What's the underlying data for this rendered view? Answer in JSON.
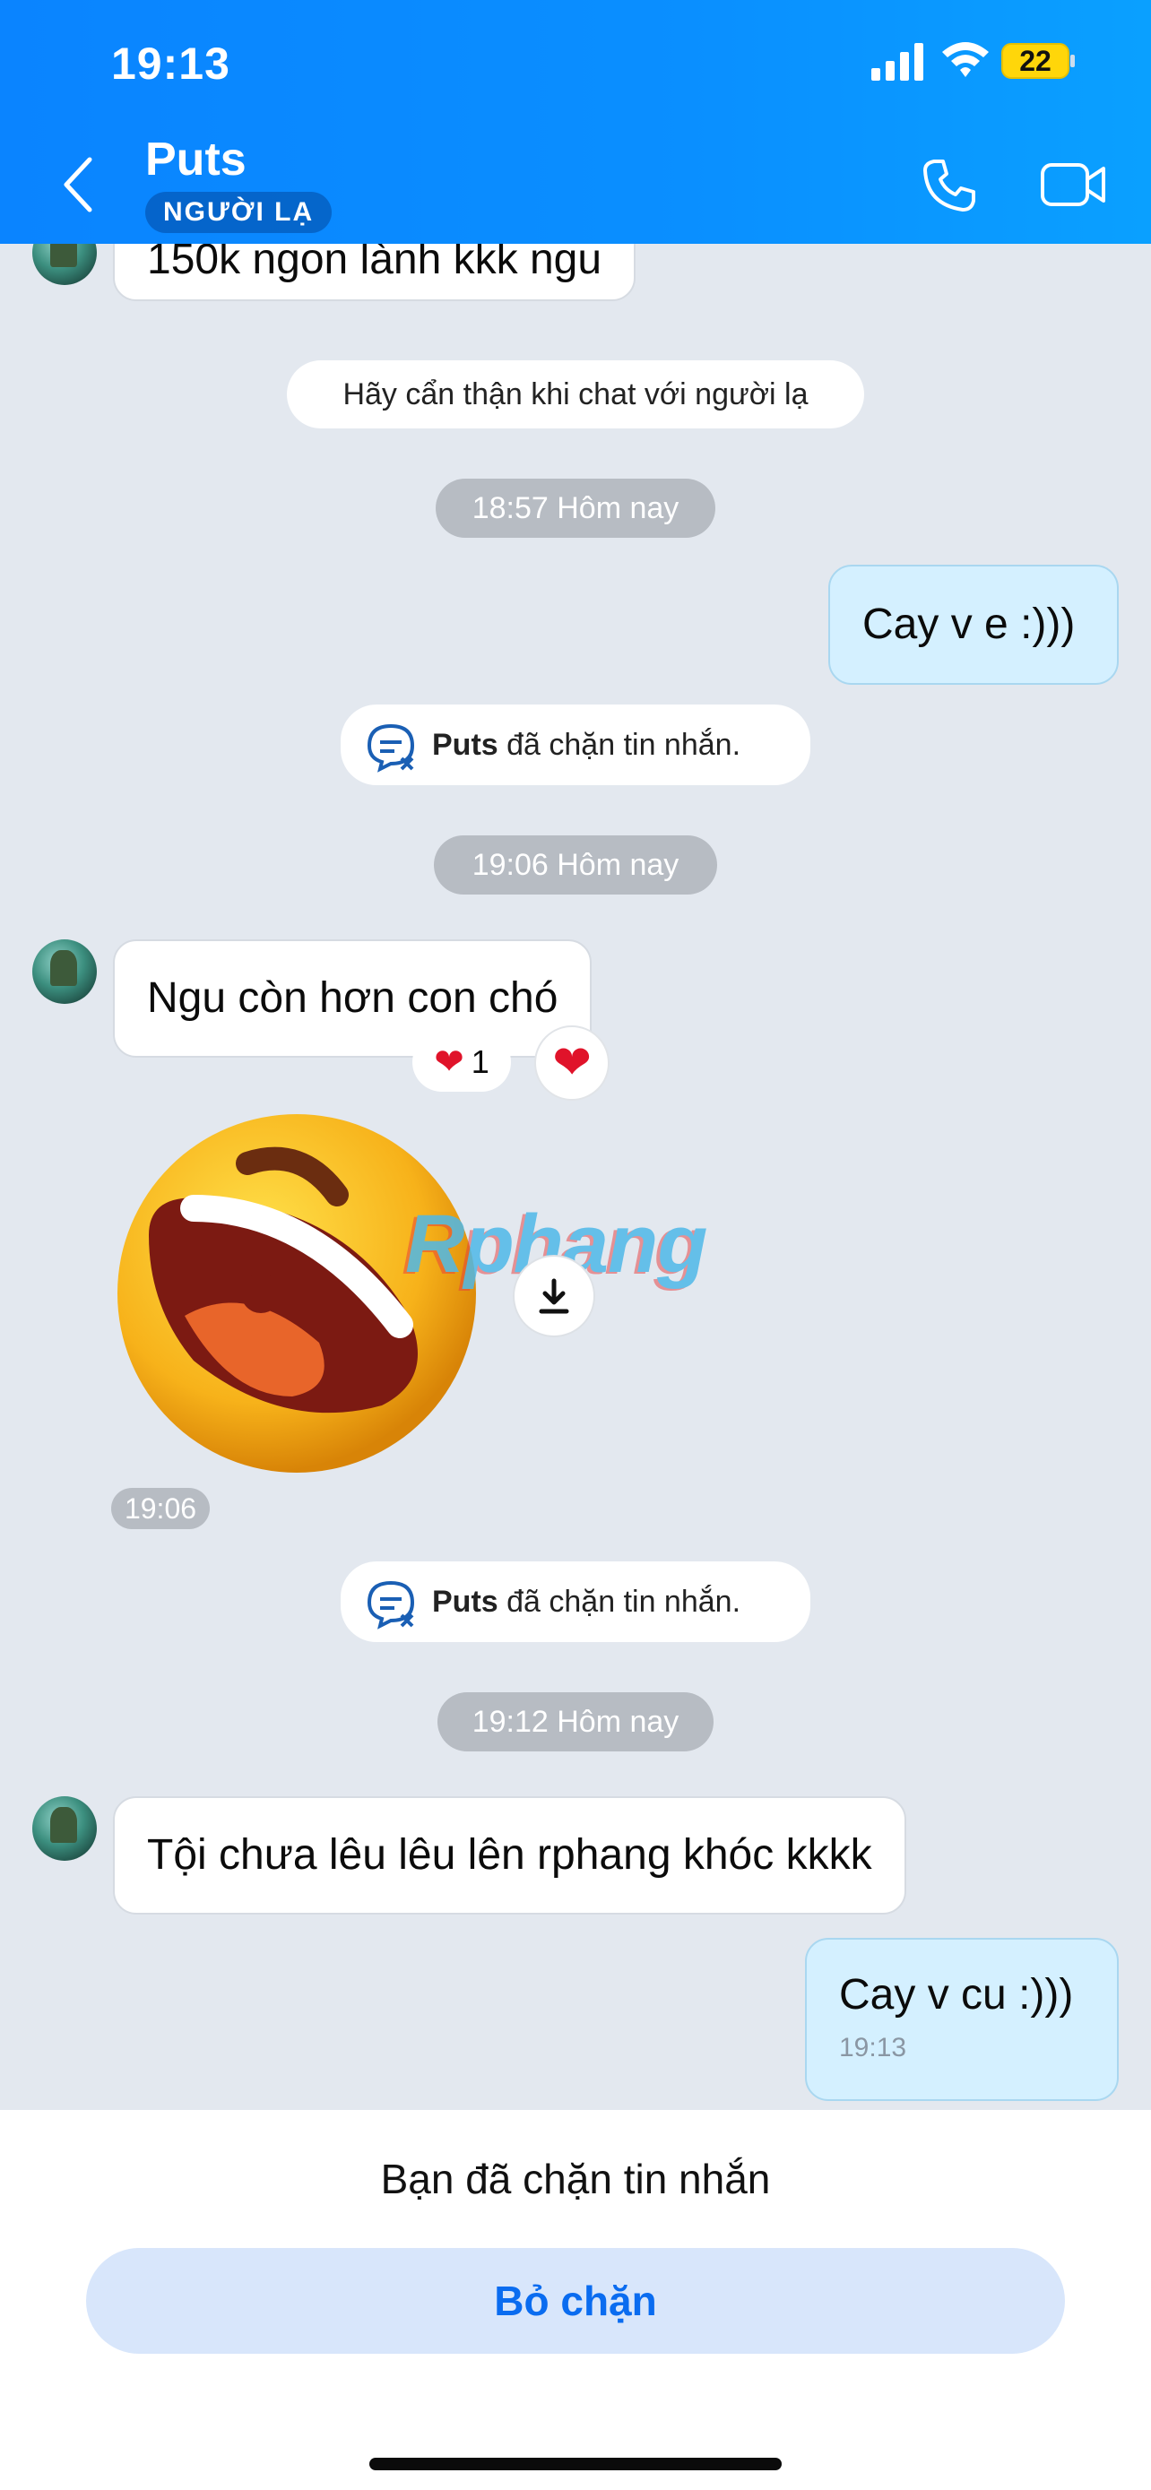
{
  "status_bar": {
    "time": "19:13",
    "battery": "22"
  },
  "header": {
    "title": "Puts",
    "badge": "NGƯỜI LẠ"
  },
  "messages": {
    "top_partial": "150k ngon lành kkk ngu",
    "warning": "Hãy cẩn thận khi chat với người lạ",
    "time1": "18:57 Hôm nay",
    "mine1": "Cay v e :)))",
    "system1": {
      "name": "Puts",
      "text": " đã chặn tin nhắn."
    },
    "time2": "19:06 Hôm nay",
    "theirs1": "Ngu còn hơn con chó",
    "reaction_count": "1",
    "sticker_time": "19:06",
    "watermark": "Rphang",
    "system2": {
      "name": "Puts",
      "text": " đã chặn tin nhắn."
    },
    "time3": "19:12 Hôm nay",
    "theirs2": "Tội chưa lêu lêu lên rphang khóc kkkk",
    "mine2": "Cay v cu :)))",
    "mine2_time": "19:13"
  },
  "bottom": {
    "blocked_notice": "Bạn đã chặn tin nhắn",
    "unblock_label": "Bỏ chặn"
  },
  "colors": {
    "header": "#0a84ff",
    "my_bubble": "#d4f0ff",
    "accent": "#0a6cf0"
  }
}
